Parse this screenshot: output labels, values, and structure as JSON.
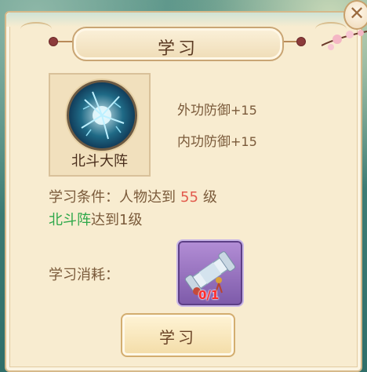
{
  "dialog": {
    "title": "学习",
    "close_glyph": "✕"
  },
  "skill": {
    "name": "北斗大阵",
    "icon": "lightning-orb-icon",
    "stats": [
      {
        "label": "外功防御",
        "value": "+15"
      },
      {
        "label": "内功防御",
        "value": "+15"
      }
    ]
  },
  "requirement": {
    "line1_prefix": "学习条件：人物达到",
    "line1_level": "55",
    "line1_suffix": "级",
    "line2_name": "北斗阵",
    "line2_suffix": "达到1级"
  },
  "cost": {
    "label": "学习消耗：",
    "item_icon": "scroll-icon",
    "count": "0/1"
  },
  "buttons": {
    "learn_label": "学习"
  },
  "colors": {
    "panel_bg": "#f8ecd0",
    "requirement_number": "#e25b4d",
    "requirement_green": "#2ea84a",
    "item_count": "#ff2b2b"
  }
}
